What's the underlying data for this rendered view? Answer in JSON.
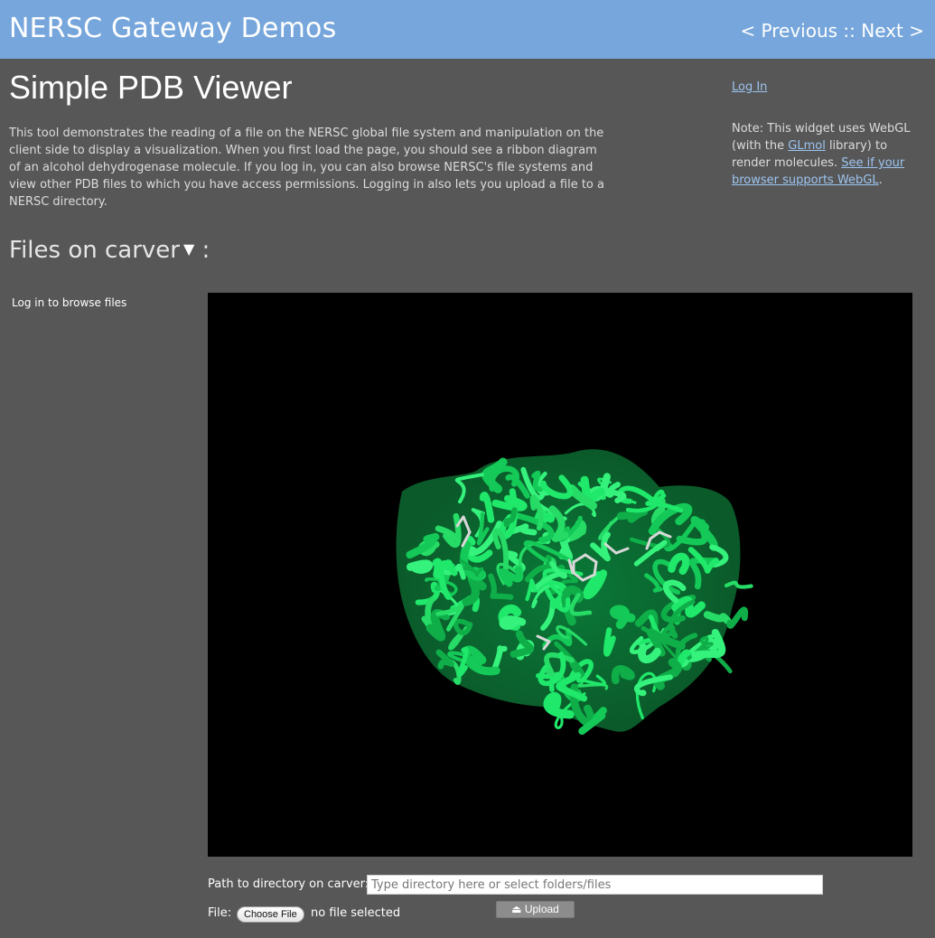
{
  "header": {
    "site_title": "NERSC Gateway Demos",
    "previous": "< Previous",
    "separator": " :: ",
    "next": "Next >"
  },
  "main": {
    "title": "Simple PDB Viewer",
    "description": "This tool demonstrates the reading of a file on the NERSC global file system and manipulation on the client side to display a visualization. When you first load the page, you should see a ribbon diagram of an alcohol dehydrogenase molecule. If you log in, you can also browse NERSC's file systems and view other PDB files to which you have access permissions. Logging in also lets you upload a file to a NERSC directory."
  },
  "sidebar": {
    "login": "Log In",
    "note_prefix": "Note: This widget uses WebGL (with the ",
    "glmol_link": "GLmol",
    "note_middle": " library) to render molecules. ",
    "webgl_link": "See if your browser supports WebGL",
    "note_suffix": "."
  },
  "files": {
    "heading": "Files on carver",
    "caret": "▼",
    "colon": " :",
    "browse_message": "Log in to browse files"
  },
  "viewer": {
    "background": "#000000",
    "ribbon_color": "#1fe86a",
    "ligand_color": "#d8d8d8"
  },
  "upload": {
    "path_label": "Path to directory on carver:",
    "path_placeholder": "Type directory here or select folders/files",
    "path_value": "",
    "file_label": "File:",
    "choose_file": "Choose File",
    "no_file": "no file selected",
    "upload_button": "⏏ Upload"
  }
}
